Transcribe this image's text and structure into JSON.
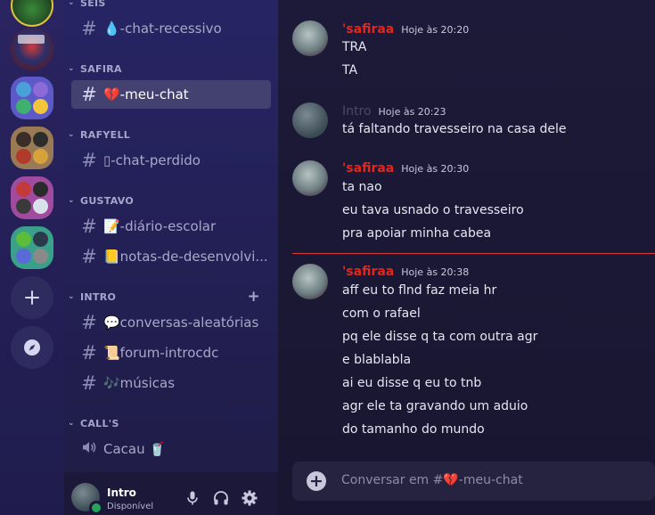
{
  "sidebar": {
    "categories": [
      {
        "label": "SEIS"
      },
      {
        "label": "SAFIRA"
      },
      {
        "label": "RAFYELL"
      },
      {
        "label": "GUSTAVO"
      },
      {
        "label": "INTRO"
      },
      {
        "label": "CALL'S"
      }
    ],
    "channels": [
      {
        "label": "💧-chat-recessivo"
      },
      {
        "label": "💔-meu-chat"
      },
      {
        "label": "▯-chat-perdido"
      },
      {
        "label": "📝-diário-escolar"
      },
      {
        "label": "📒notas-de-desenvolvi..."
      },
      {
        "label": "💬conversas-aleatórias"
      },
      {
        "label": "📜forum-introcdc"
      },
      {
        "label": "🎶músicas"
      },
      {
        "label": "Cacau 🥤"
      }
    ]
  },
  "user": {
    "name": "Intro",
    "status": "Disponível",
    "status_color": "#23a55a"
  },
  "chat": {
    "messages": [
      {
        "author": "'safiraa",
        "author_color": "#e0281f",
        "time": "Hoje às 20:20",
        "lines": [
          "TRA",
          "TA"
        ]
      },
      {
        "author": "Intro",
        "author_color": "#4a4869",
        "time": "Hoje às 20:23",
        "lines": [
          "tá faltando travesseiro na casa dele"
        ]
      },
      {
        "author": "'safiraa",
        "author_color": "#e0281f",
        "time": "Hoje às 20:30",
        "lines": [
          "ta nao",
          "eu tava usnado o travesseiro",
          "pra apoiar minha cabea"
        ]
      },
      {
        "author": "'safiraa",
        "author_color": "#e0281f",
        "time": "Hoje às 20:38",
        "lines": [
          "aff eu to flnd faz meia hr",
          "com o rafael",
          "pq ele disse q ta com outra agr",
          "e blablabla",
          "ai eu disse q eu to tnb",
          "agr ele ta gravando um aduio",
          "do tamanho do mundo"
        ]
      }
    ],
    "composer_placeholder": "Conversar em #💔-meu-chat"
  },
  "colors": {
    "active_channel_bg": "#434170",
    "new_messages_divider": "#d83c3e"
  }
}
